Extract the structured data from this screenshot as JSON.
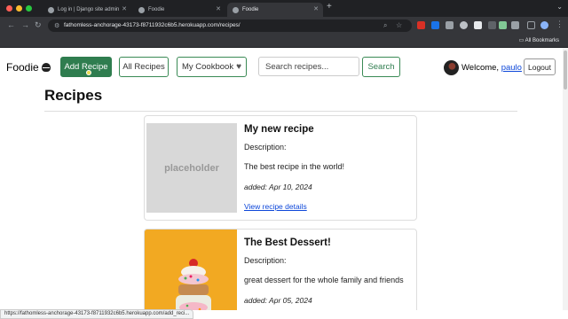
{
  "browser": {
    "tabs": [
      {
        "title": "Log in | Django site admin",
        "active": false
      },
      {
        "title": "Foodie",
        "active": false
      },
      {
        "title": "Foodie",
        "active": true
      }
    ],
    "url": "fathomless-anchorage-43173-f8711932c6b5.herokuapp.com/recipes/",
    "bookmarks_label": "All Bookmarks",
    "status_url": "https://fathomless-anchorage-43173-f8711932c6b5.herokuapp.com/add_reci..."
  },
  "navbar": {
    "brand": "Foodie",
    "add_recipe": "Add Recipe",
    "all_recipes": "All Recipes",
    "my_cookbook": "My Cookbook",
    "search_placeholder": "Search recipes...",
    "search_button": "Search",
    "welcome": "Welcome,",
    "username": "paulo",
    "logout": "Logout"
  },
  "page": {
    "heading": "Recipes"
  },
  "recipes": [
    {
      "image_text": "placeholder",
      "title": "My new recipe",
      "description_label": "Description:",
      "description": "The best recipe in the world!",
      "added": "added: Apr 10, 2024",
      "link": "View recipe details"
    },
    {
      "title": "The Best Dessert!",
      "description_label": "Description:",
      "description": "great dessert for the whole family and friends",
      "added": "added: Apr 05, 2024"
    }
  ],
  "colors": {
    "primary_green": "#2f7d4f",
    "link_blue": "#0d47d9"
  }
}
